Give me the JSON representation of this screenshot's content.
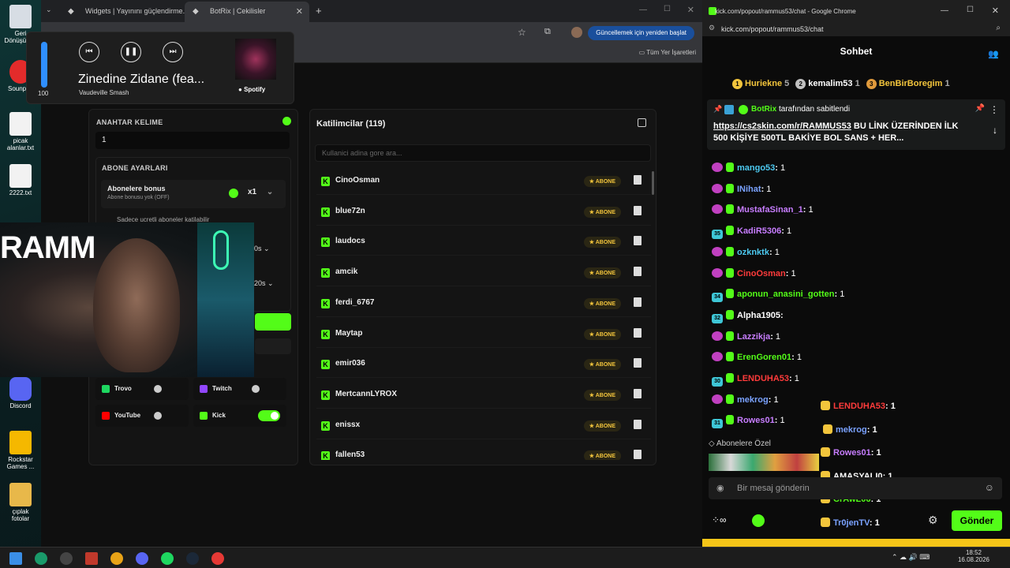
{
  "desktop": {
    "icons": [
      {
        "label": "Geri Dönüşüm..."
      },
      {
        "label": "Sounpad"
      },
      {
        "label": "picak alanlar.txt"
      },
      {
        "label": "2222.txt"
      },
      {
        "label": "Discord"
      },
      {
        "label": "Rockstar Games ..."
      },
      {
        "label": "çıplak fotolar"
      }
    ]
  },
  "browser_left": {
    "tabs": [
      {
        "label": "Widgets | Yayınını güçlendirme..."
      },
      {
        "label": "BotRix | Cekilisler"
      }
    ],
    "update_button": "Güncellemek için yeniden başlat",
    "bookmarks_label": "Tüm Yer İşaretleri"
  },
  "media": {
    "volume": "100",
    "title": "Zinedine Zidane (fea...",
    "artist": "Vaudeville Smash",
    "source": "Spotify"
  },
  "keyword_panel": {
    "keyword_label": "ANAHTAR KELIME",
    "keyword_value": "1",
    "sub_settings_label": "ABONE AYARLARI",
    "bonus_title": "Abonelere bonus",
    "bonus_sub": "Abone bonusu yok (OFF)",
    "multiplier": "x1",
    "paid_only": "Sadece ucretli aboneler katilabilir",
    "dropdown1": "0s",
    "dropdown2": "20s",
    "platforms": [
      {
        "name": "Trovo",
        "on": false,
        "color": "#1ed760"
      },
      {
        "name": "Twitch",
        "on": false,
        "color": "#9146ff"
      },
      {
        "name": "YouTube",
        "on": false,
        "color": "#ff0000"
      },
      {
        "name": "Kick",
        "on": true,
        "color": "#53fc18"
      }
    ]
  },
  "participants": {
    "title": "Katilimcilar (119)",
    "search_placeholder": "Kullanici adina gore ara...",
    "badge": "ABONE",
    "rows": [
      "CinoOsman",
      "blue72n",
      "laudocs",
      "amcik",
      "ferdi_6767",
      "Maytap",
      "emir036",
      "MertcannLYROX",
      "enissx",
      "fallen53"
    ]
  },
  "browser_right": {
    "window_title": "kick.com/popout/rammus53/chat - Google Chrome",
    "url": "kick.com/popout/rammus53/chat"
  },
  "chat": {
    "header": "Sohbet",
    "top_gifters": [
      {
        "rank": "1",
        "name": "Huriekne",
        "count": "5"
      },
      {
        "rank": "2",
        "name": "kemalim53",
        "count": "1"
      },
      {
        "rank": "3",
        "name": "BenBirBoregim",
        "count": "1"
      }
    ],
    "pinned_by": "BotRix",
    "pinned_suffix": "tarafından sabitlendi",
    "pinned_link": "https://cs2skin.com/r/RAMMUS53",
    "pinned_text": "BU LİNK ÜZERİNDEN İLK 500 KİŞİYE 500TL BAKİYE BOL SANS + HER...",
    "messages": [
      {
        "user": "mango53",
        "text": "1",
        "color": "#4cc9f0",
        "badge": ""
      },
      {
        "user": "INihat",
        "text": "1",
        "color": "#7aa2ff",
        "badge": ""
      },
      {
        "user": "MustafaSinan_1",
        "text": "1",
        "color": "#c77dff",
        "badge": ""
      },
      {
        "user": "KadiR5306",
        "text": "1",
        "color": "#c77dff",
        "badge": "35"
      },
      {
        "user": "ozknktk",
        "text": "1",
        "color": "#4cc9f0",
        "badge": ""
      },
      {
        "user": "CinoOsman",
        "text": "1",
        "color": "#ff3b3b",
        "badge": ""
      },
      {
        "user": "aponun_anasini_gotten",
        "text": "1",
        "color": "#53fc18",
        "badge": "34"
      },
      {
        "user": "Alpha1905",
        "text": "",
        "color": "#ffffff",
        "badge": "32"
      },
      {
        "user": "Lazzikja",
        "text": "1",
        "color": "#c77dff",
        "badge": ""
      },
      {
        "user": "ErenGoren01",
        "text": "1",
        "color": "#53fc18",
        "badge": ""
      },
      {
        "user": "LENDUHA53",
        "text": "1",
        "color": "#ff3b3b",
        "badge": "30"
      },
      {
        "user": "mekrog",
        "text": "1",
        "color": "#7aa2ff",
        "badge": ""
      },
      {
        "user": "Rowes01",
        "text": "1",
        "color": "#c77dff",
        "badge": "31"
      }
    ],
    "overlay_lines": [
      {
        "user": "LENDUHA53",
        "text": "1",
        "color": "#ff3b3b"
      },
      {
        "user": "mekrog",
        "text": "1",
        "color": "#7aa2ff"
      },
      {
        "user": "Rowes01",
        "text": "1",
        "color": "#c77dff"
      },
      {
        "user": "AMASYALI0",
        "text": "1",
        "color": "#ffffff"
      },
      {
        "user": "CrAwL06",
        "text": "1",
        "color": "#53fc18"
      },
      {
        "user": "Tr0jenTV",
        "text": "1",
        "color": "#7aa2ff"
      }
    ],
    "subs_only_label": "Abonelere Özel",
    "input_placeholder": "Bir mesaj gönderin",
    "send_label": "Gönder"
  },
  "taskbar": {
    "time": "18:52",
    "date": "16.08.2026"
  },
  "stream_overlay_text": "RAMM"
}
